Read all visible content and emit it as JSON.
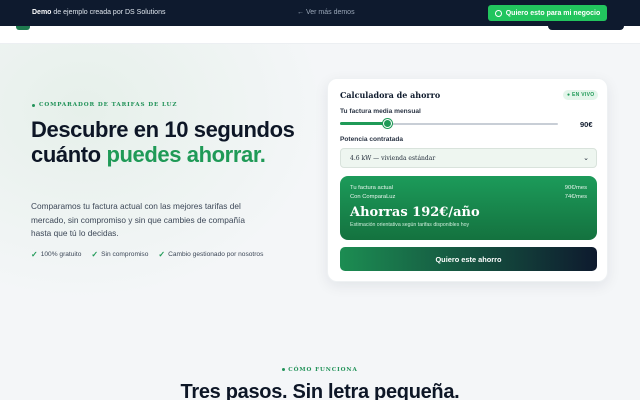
{
  "demo_bar": {
    "brand": "Demo",
    "text": " de ejemplo creada por DS Solutions",
    "link": "← Ver más demos",
    "cta": "Quiero esto para mi negocio",
    "cta_icon": "whatsapp-icon"
  },
  "hero": {
    "eyebrow": "COMPARADOR DE TARIFAS DE LUZ",
    "title_part1": "Descubre en 10 segundos cuánto ",
    "title_accent": "puedes ahorrar.",
    "subtitle": "Comparamos tu factura actual con las mejores tarifas del mercado, sin compromiso y sin que cambies de compañía hasta que tú lo decidas.",
    "checks": [
      "100% gratuito",
      "Sin compromiso",
      "Cambio gestionado por nosotros"
    ]
  },
  "calculator": {
    "title": "Calculadora de ahorro",
    "badge": "● EN VIVO",
    "bill_label": "Tu factura media mensual",
    "bill_value": "90€",
    "bill_slider_fraction": 0.22,
    "power_label": "Potencia contratada",
    "power_selected": "4.6 kW — vivienda estándar",
    "result": {
      "current_label": "Tu factura actual",
      "current_value": "90€/mes",
      "with_label": "Con ComparaLuz",
      "with_value": "74€/mes",
      "headline": "Ahorras 192€/año",
      "note": "Estimación orientativa según tarifas disponibles hoy"
    },
    "cta": "Quiero este ahorro"
  },
  "how": {
    "eyebrow": "CÓMO FUNCIONA",
    "title": "Tres pasos. Sin letra pequeña."
  },
  "colors": {
    "accent": "#1f9a57",
    "navy": "#0e1a2e",
    "whatsapp_green": "#22c55e"
  }
}
